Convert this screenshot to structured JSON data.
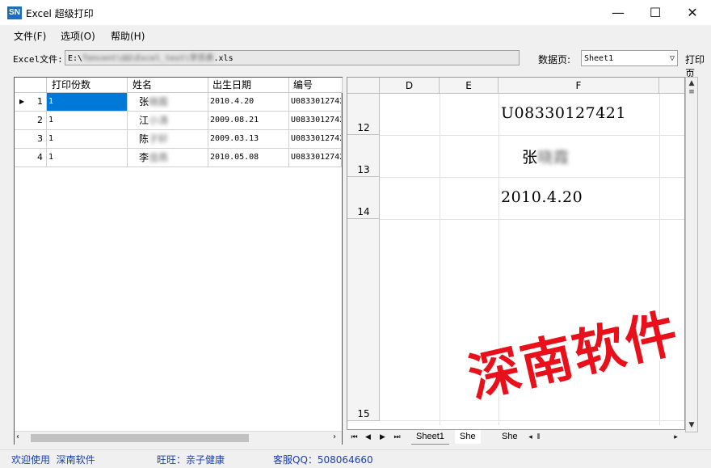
{
  "window": {
    "icon_text": "SN",
    "title": "Excel 超级打印",
    "minimize": "—",
    "maximize": "☐",
    "close": "✕"
  },
  "menu": {
    "file": "文件(F)",
    "options": "选项(O)",
    "help": "帮助(H)"
  },
  "file_row": {
    "label": "Excel文件:",
    "path_prefix": "E:\\",
    "path_blurred": "Tencent\\QQ\\Excel_test\\学员表",
    "path_suffix": ".xls",
    "sheet_label": "数据页:",
    "sheet_value": "Sheet1",
    "print_label": "打印页"
  },
  "grid": {
    "headers": [
      "打印份数",
      "姓名",
      "出生日期",
      "编号"
    ],
    "rows": [
      {
        "index": "1",
        "copies": "1",
        "name_first": "张",
        "name_rest": "晓霞",
        "birth": "2010.4.20",
        "id": "U0833012742",
        "current": true
      },
      {
        "index": "2",
        "copies": "1",
        "name_first": "江",
        "name_rest": "小涛",
        "birth": "2009.08.21",
        "id": "U0833012742",
        "current": false
      },
      {
        "index": "3",
        "copies": "1",
        "name_first": "陈",
        "name_rest": "子轩",
        "birth": "2009.03.13",
        "id": "U0833012742",
        "current": false
      },
      {
        "index": "4",
        "copies": "1",
        "name_first": "李",
        "name_rest": "佳燕",
        "birth": "2010.05.08",
        "id": "U0833012742",
        "current": false
      }
    ]
  },
  "sheet": {
    "columns": [
      "D",
      "E",
      "F"
    ],
    "rows": [
      "12",
      "13",
      "14",
      "15"
    ],
    "cell_id": "U08330127421",
    "cell_name_first": "张",
    "cell_name_rest": "晓霞",
    "cell_birth": "2010.4.20",
    "tabs": [
      "Sheet1",
      "She",
      "She"
    ]
  },
  "watermark": "深南软件",
  "status": {
    "welcome": "欢迎使用  深南软件",
    "wangwang": "旺旺：亲子健康",
    "qq": "客服QQ：508064660"
  },
  "colors": {
    "selection": "#0078d7",
    "status_text": "#1b3fa8",
    "watermark": "#e8101a"
  }
}
